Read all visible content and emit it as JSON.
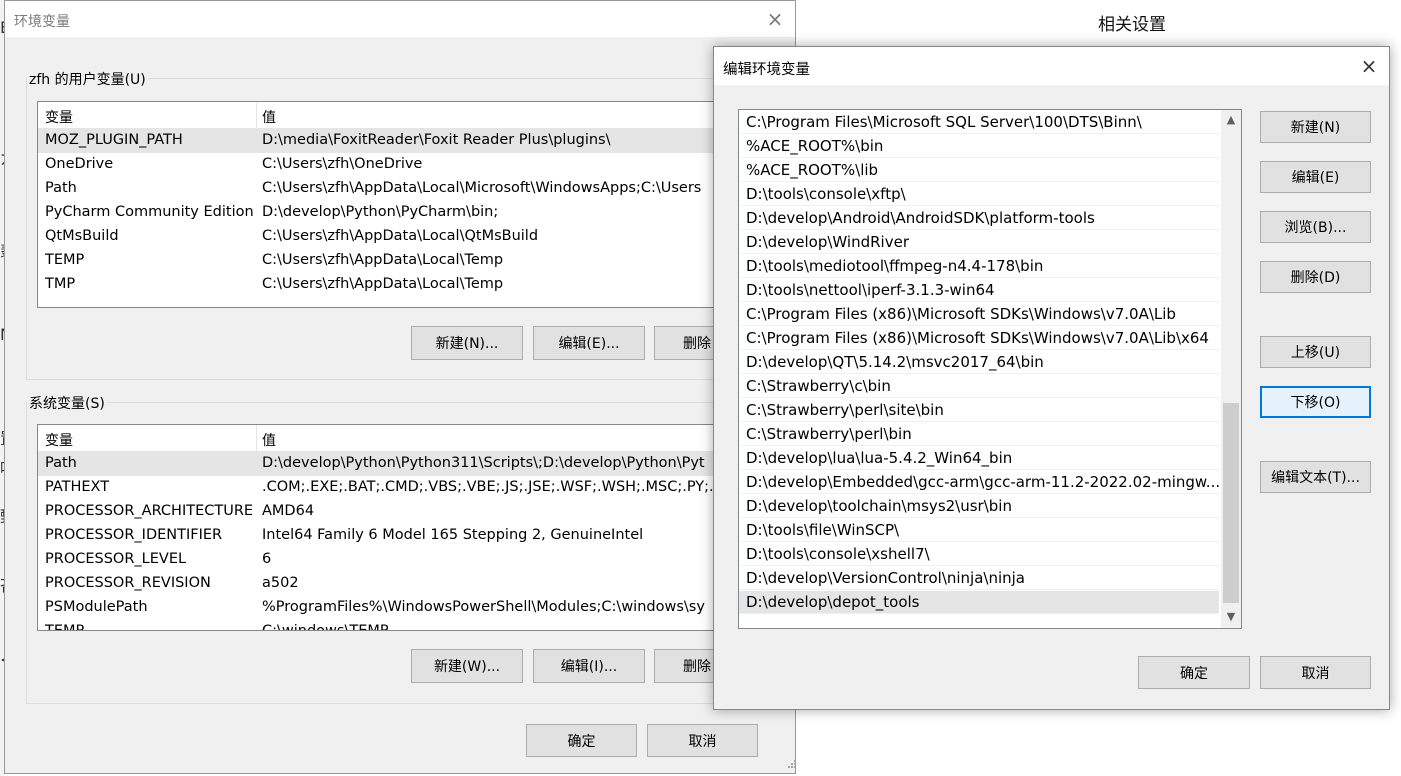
{
  "background": {
    "title": "相关设置",
    "fragments": [
      "E",
      "ガ",
      "〈",
      "翡",
      "N",
      "置",
      "啰",
      "甄",
      "吝",
      "<"
    ]
  },
  "env_dialog": {
    "title": "环境变量",
    "user_group": {
      "label": "zfh 的用户变量(U)",
      "columns": [
        "变量",
        "值"
      ],
      "rows": [
        {
          "name": "MOZ_PLUGIN_PATH",
          "value": "D:\\media\\FoxitReader\\Foxit Reader Plus\\plugins\\"
        },
        {
          "name": "OneDrive",
          "value": "C:\\Users\\zfh\\OneDrive"
        },
        {
          "name": "Path",
          "value": "C:\\Users\\zfh\\AppData\\Local\\Microsoft\\WindowsApps;C:\\Users"
        },
        {
          "name": "PyCharm Community Edition",
          "value": "D:\\develop\\Python\\PyCharm\\bin;"
        },
        {
          "name": "QtMsBuild",
          "value": "C:\\Users\\zfh\\AppData\\Local\\QtMsBuild"
        },
        {
          "name": "TEMP",
          "value": "C:\\Users\\zfh\\AppData\\Local\\Temp"
        },
        {
          "name": "TMP",
          "value": "C:\\Users\\zfh\\AppData\\Local\\Temp"
        }
      ],
      "buttons": {
        "new": "新建(N)...",
        "edit": "编辑(E)...",
        "delete": "删除"
      }
    },
    "system_group": {
      "label": "系统变量(S)",
      "columns": [
        "变量",
        "值"
      ],
      "rows": [
        {
          "name": "Path",
          "value": "D:\\develop\\Python\\Python311\\Scripts\\;D:\\develop\\Python\\Pyt"
        },
        {
          "name": "PATHEXT",
          "value": ".COM;.EXE;.BAT;.CMD;.VBS;.VBE;.JS;.JSE;.WSF;.WSH;.MSC;.PY;.PY"
        },
        {
          "name": "PROCESSOR_ARCHITECTURE",
          "value": "AMD64"
        },
        {
          "name": "PROCESSOR_IDENTIFIER",
          "value": "Intel64 Family 6 Model 165 Stepping 2, GenuineIntel"
        },
        {
          "name": "PROCESSOR_LEVEL",
          "value": "6"
        },
        {
          "name": "PROCESSOR_REVISION",
          "value": "a502"
        },
        {
          "name": "PSModulePath",
          "value": "%ProgramFiles%\\WindowsPowerShell\\Modules;C:\\windows\\sy"
        },
        {
          "name": "TEMP",
          "value": "C:\\windows\\TEMP"
        }
      ],
      "buttons": {
        "new": "新建(W)...",
        "edit": "编辑(I)...",
        "delete": "删除"
      }
    },
    "ok": "确定",
    "cancel": "取消"
  },
  "edit_dialog": {
    "title": "编辑环境变量",
    "paths": [
      "C:\\Program Files\\Microsoft SQL Server\\100\\DTS\\Binn\\",
      "%ACE_ROOT%\\bin",
      "%ACE_ROOT%\\lib",
      "D:\\tools\\console\\xftp\\",
      "D:\\develop\\Android\\AndroidSDK\\platform-tools",
      "D:\\develop\\WindRiver",
      "D:\\tools\\mediotool\\ffmpeg-n4.4-178\\bin",
      "D:\\tools\\nettool\\iperf-3.1.3-win64",
      "C:\\Program Files (x86)\\Microsoft SDKs\\Windows\\v7.0A\\Lib",
      "C:\\Program Files (x86)\\Microsoft SDKs\\Windows\\v7.0A\\Lib\\x64",
      "D:\\develop\\QT\\5.14.2\\msvc2017_64\\bin",
      "C:\\Strawberry\\c\\bin",
      "C:\\Strawberry\\perl\\site\\bin",
      "C:\\Strawberry\\perl\\bin",
      "D:\\develop\\lua\\lua-5.4.2_Win64_bin",
      "D:\\develop\\Embedded\\gcc-arm\\gcc-arm-11.2-2022.02-mingw...",
      "D:\\develop\\toolchain\\msys2\\usr\\bin",
      "D:\\tools\\file\\WinSCP\\",
      "D:\\tools\\console\\xshell7\\",
      "D:\\develop\\VersionControl\\ninja\\ninja",
      "D:\\develop\\depot_tools"
    ],
    "selected_index": 20,
    "scroll_up_glyph": "▲",
    "scroll_down_glyph": "▼",
    "buttons": {
      "new": "新建(N)",
      "edit": "编辑(E)",
      "browse": "浏览(B)...",
      "delete": "删除(D)",
      "move_up": "上移(U)",
      "move_down": "下移(O)",
      "edit_text": "编辑文本(T)..."
    },
    "ok": "确定",
    "cancel": "取消"
  },
  "icons": {
    "close": "×"
  },
  "colors": {
    "dialog_bg": "#f0f0f0",
    "focus_border": "#0078d7",
    "selection": "#e5e5e5"
  }
}
